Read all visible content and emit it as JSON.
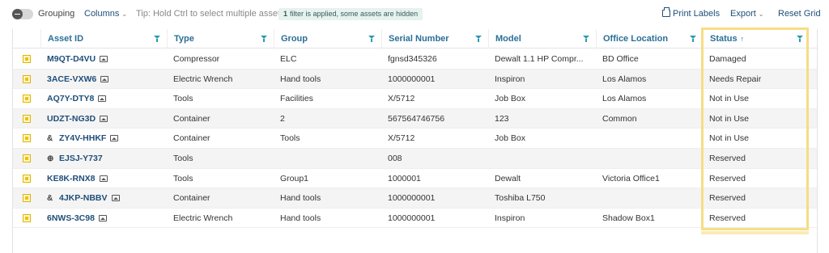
{
  "toolbar": {
    "grouping_label": "Grouping",
    "columns_label": "Columns",
    "tip": "Tip: Hold Ctrl to select multiple assets.",
    "filter_count": "1",
    "filter_text": "filter is applied, some assets are hidden",
    "print_label": "Print Labels",
    "export_label": "Export",
    "reset_label": "Reset Grid"
  },
  "columns": [
    "Asset ID",
    "Type",
    "Group",
    "Serial Number",
    "Model",
    "Office Location",
    "Status"
  ],
  "rows": [
    {
      "id": "M9QT-D4VU",
      "pre": "",
      "img": true,
      "type": "Compressor",
      "group": "ELC",
      "serial": "fgnsd345326",
      "model": "Dewalt 1.1 HP Compr...",
      "location": "BD Office",
      "status": "Damaged"
    },
    {
      "id": "3ACE-VXW6",
      "pre": "",
      "img": true,
      "type": "Electric Wrench",
      "group": "Hand tools",
      "serial": "1000000001",
      "model": "Inspiron",
      "location": "Los Alamos",
      "status": "Needs Repair"
    },
    {
      "id": "AQ7Y-DTY8",
      "pre": "",
      "img": true,
      "type": "Tools",
      "group": "Facilities",
      "serial": "X/5712",
      "model": "Job Box",
      "location": "Los Alamos",
      "status": "Not in Use"
    },
    {
      "id": "UDZT-NG3D",
      "pre": "",
      "img": true,
      "type": "Container",
      "group": "2",
      "serial": "567564746756",
      "model": "123",
      "location": "Common",
      "status": "Not in Use"
    },
    {
      "id": "ZY4V-HHKF",
      "pre": "&",
      "img": true,
      "type": "Container",
      "group": "Tools",
      "serial": "X/5712",
      "model": "Job Box",
      "location": "",
      "status": "Not in Use"
    },
    {
      "id": "EJSJ-Y737",
      "pre": "⊕",
      "img": false,
      "type": "Tools",
      "group": "",
      "serial": "008",
      "model": "",
      "location": "",
      "status": "Reserved"
    },
    {
      "id": "KE8K-RNX8",
      "pre": "",
      "img": true,
      "type": "Tools",
      "group": "Group1",
      "serial": "1000001",
      "model": "Dewalt",
      "location": "Victoria Office1",
      "status": "Reserved"
    },
    {
      "id": "4JKP-NBBV",
      "pre": "&",
      "img": true,
      "type": "Container",
      "group": "Hand tools",
      "serial": "1000000001",
      "model": "Toshiba L750",
      "location": "",
      "status": "Reserved"
    },
    {
      "id": "6NWS-3C98",
      "pre": "",
      "img": true,
      "type": "Electric Wrench",
      "group": "Hand tools",
      "serial": "1000000001",
      "model": "Inspiron",
      "location": "Shadow Box1",
      "status": "Reserved"
    }
  ],
  "colors": {
    "link": "#1f4e79",
    "header": "#2a6f97",
    "highlight": "#f7dd84",
    "checkbox": "#f0c000"
  },
  "icons": {
    "toggle": "toggle-switch-icon",
    "print": "printer-icon",
    "filter": "filter-icon",
    "image": "image-icon",
    "sort": "sort-up-arrow-icon"
  }
}
